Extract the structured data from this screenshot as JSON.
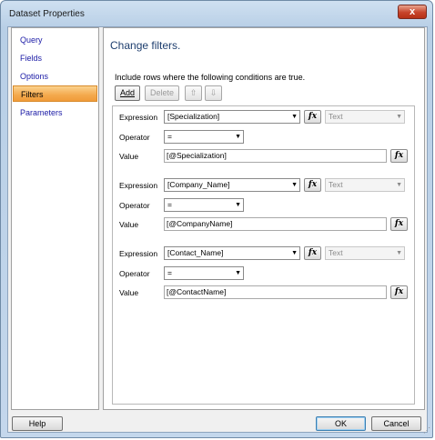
{
  "window": {
    "title": "Dataset Properties",
    "close_glyph": "x"
  },
  "nav": {
    "items": [
      {
        "label": "Query"
      },
      {
        "label": "Fields"
      },
      {
        "label": "Options"
      },
      {
        "label": "Filters",
        "selected": true
      },
      {
        "label": "Parameters"
      }
    ]
  },
  "main": {
    "heading": "Change filters.",
    "description": "Include rows where the following conditions are true.",
    "toolbar": {
      "add_label": "Add",
      "delete_label": "Delete",
      "move_up_glyph": "⇧",
      "move_down_glyph": "⇩"
    },
    "labels": {
      "expression": "Expression",
      "operator": "Operator",
      "value": "Value",
      "fx": "fx"
    },
    "filters": [
      {
        "expression": "[Specialization]",
        "type": "Text",
        "operator": "=",
        "value": "[@Specialization]"
      },
      {
        "expression": "[Company_Name]",
        "type": "Text",
        "operator": "=",
        "value": "[@CompanyName]"
      },
      {
        "expression": "[Contact_Name]",
        "type": "Text",
        "operator": "=",
        "value": "[@ContactName]"
      }
    ]
  },
  "footer": {
    "help_label": "Help",
    "ok_label": "OK",
    "cancel_label": "Cancel"
  },
  "colors": {
    "selected_nav": "#f4a94c",
    "heading": "#1e3e6e",
    "link": "#1a1aa6"
  }
}
